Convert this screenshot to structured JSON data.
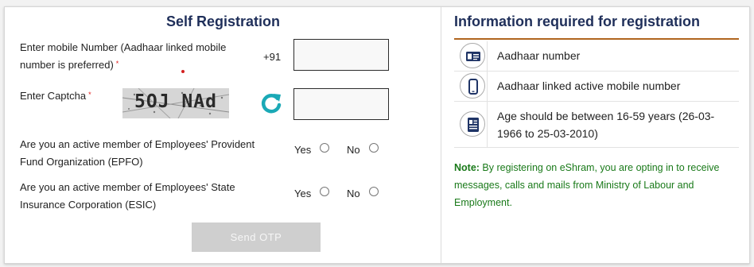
{
  "left": {
    "title": "Self Registration",
    "mobile_label_1": "Enter mobile Number (Aadhaar linked mobile",
    "mobile_label_2": "number is preferred)",
    "required_mark": "*",
    "country_code": "+91",
    "mobile_value": "",
    "captcha_label": "Enter Captcha",
    "captcha_text": "5OJ NAd",
    "captcha_value": "",
    "epfo_q1": "Are you an active member of Employees' Provident",
    "epfo_q2": "Fund Organization (EPFO)",
    "esic_q1": "Are you an active member of Employees' State",
    "esic_q2": "Insurance Corporation (ESIC)",
    "yes": "Yes",
    "no": "No",
    "send_otp": "Send OTP"
  },
  "right": {
    "title": "Information required for registration",
    "items": [
      {
        "icon": "id-card-icon",
        "text": "Aadhaar number"
      },
      {
        "icon": "mobile-phone-icon",
        "text": "Aadhaar linked active mobile number"
      },
      {
        "icon": "id-card-icon",
        "text_1": "Age should be between 16-59 years (26-03-",
        "text_2": "1966 to 25-03-2010)"
      }
    ],
    "note_label": "Note:",
    "note_1": " By registering on eShram, you are opting in to receive",
    "note_2": "messages, calls and mails from Ministry of Labour and",
    "note_3": "Employment."
  },
  "colors": {
    "heading": "#1f2f5a",
    "accent_rule": "#b0651f",
    "note_green": "#1a7a1a",
    "refresh_teal": "#1aa9b6",
    "icon_navy": "#1f3466",
    "required_red": "#e01a1a"
  }
}
